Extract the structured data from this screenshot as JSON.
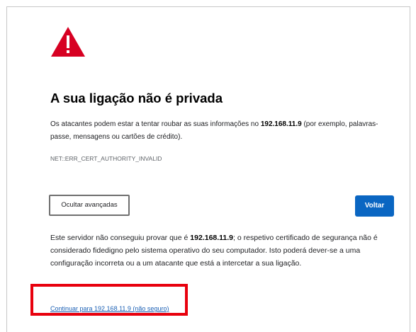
{
  "page": {
    "title": "A sua ligação não é privada",
    "description": {
      "before": "Os atacantes podem estar a tentar roubar as suas informações no ",
      "host": "192.168.11.9",
      "after": " (por exemplo, palavras-passe, mensagens ou cartões de crédito)."
    },
    "error_code": "NET::ERR_CERT_AUTHORITY_INVALID"
  },
  "buttons": {
    "advanced_label": "Ocultar avançadas",
    "back_label": "Voltar"
  },
  "details": {
    "before": "Este servidor não conseguiu provar que é ",
    "host": "192.168.11.9",
    "after": "; o respetivo certificado de segurança não é considerado fidedigno pelo sistema operativo do seu computador. Isto poderá dever-se a uma configuração incorreta ou a um atacante que está a intercetar a sua ligação."
  },
  "proceed_link": "Continuar para 192.168.11.9 (não seguro)",
  "colors": {
    "warning_icon": "#d70022",
    "primary_button": "#0a66c2",
    "highlight_box": "#e8000d",
    "link": "#1a5fb4"
  },
  "icons": {
    "warning": "warning-triangle-icon"
  }
}
